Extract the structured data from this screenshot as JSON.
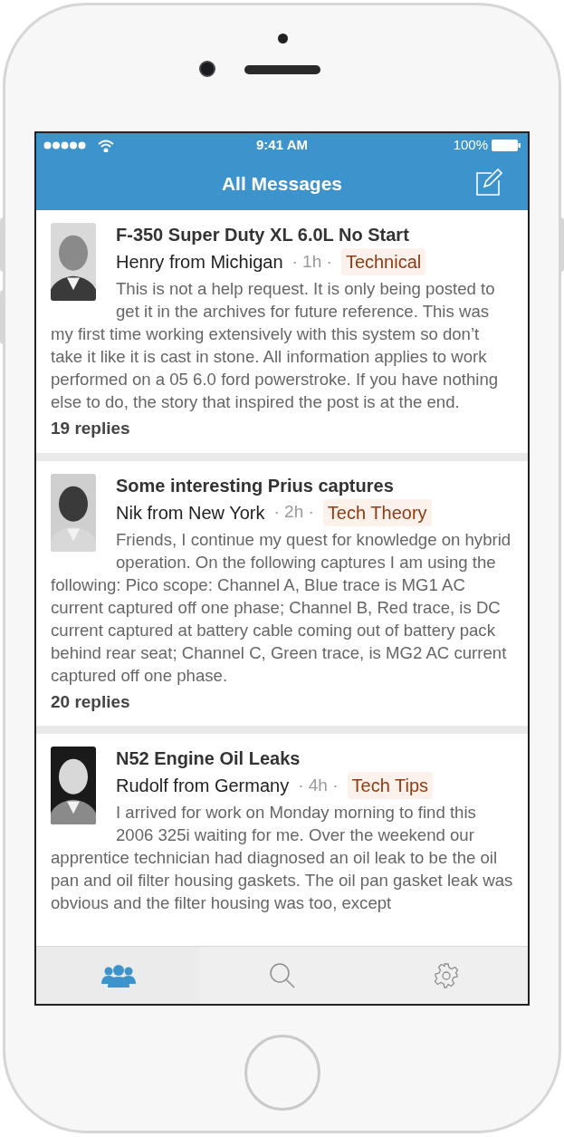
{
  "status_bar": {
    "time": "9:41 AM",
    "battery": "100%"
  },
  "nav_bar": {
    "title": "All Messages"
  },
  "posts": [
    {
      "title": "F-350 Super Duty XL 6.0L No Start",
      "author": "Henry from Michigan",
      "age": "· 1h ·",
      "category": "Technical",
      "body": "This is not a help request. It is only being posted to get it in the archives for future reference. This was my first time working extensively with this system so don’t take it like it is cast in stone. All information applies to work performed on a 05 6.0 ford powerstroke. If you have nothing else to do, the story that inspired the post is at the end.",
      "replies": "19 replies"
    },
    {
      "title": "Some interesting Prius captures",
      "author": "Nik from New York",
      "age": "· 2h ·",
      "category": "Tech Theory",
      "body": "Friends, I continue my quest for knowledge on hybrid operation. On the following captures I am using the following: Pico scope: Channel A, Blue trace is MG1 AC current captured off one phase; Channel B, Red trace, is DC current captured at battery cable coming out of battery pack behind rear seat; Channel C, Green trace, is MG2 AC current captured off one phase.",
      "replies": "20 replies"
    },
    {
      "title": "N52 Engine Oil Leaks",
      "author": "Rudolf from Germany",
      "age": "· 4h ·",
      "category": "Tech Tips",
      "body": "I arrived for work on Monday morning to find this 2006 325i waiting for me. Over the weekend our apprentice technician had diagnosed an oil leak to be the oil pan and oil filter housing gaskets. The oil pan gasket leak was obvious and the filter housing was too, except"
    }
  ],
  "tab_bar": [
    {
      "kind": "people",
      "selected": true
    },
    {
      "kind": "search",
      "selected": false
    },
    {
      "kind": "settings",
      "selected": false
    }
  ]
}
